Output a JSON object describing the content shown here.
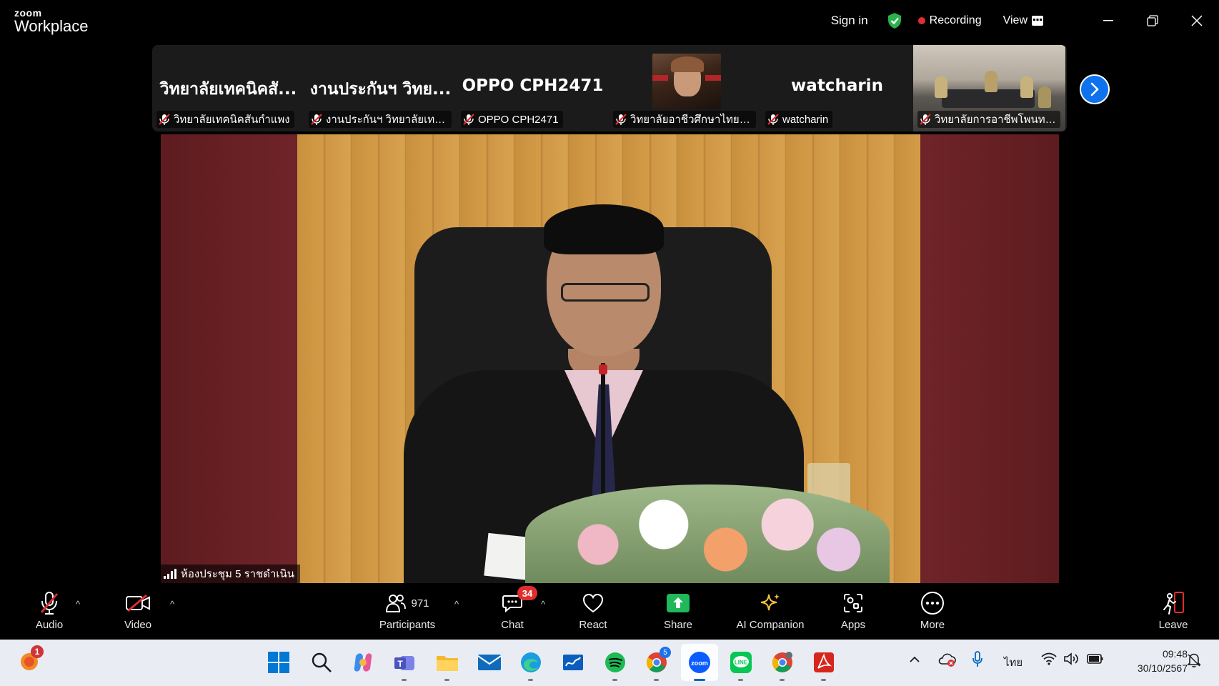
{
  "app": {
    "logo_line1": "zoom",
    "logo_line2": "Workplace",
    "sign_in": "Sign in",
    "recording": "Recording",
    "view": "View"
  },
  "thumbnails": [
    {
      "big_name": "วิทยาลัยเทคนิคสั...",
      "caption": "วิทยาลัยเทคนิคสันกำแพง",
      "type": "name"
    },
    {
      "big_name": "งานประกันฯ วิทย...",
      "caption": "งานประกันฯ วิทยาลัยเทคนิ...",
      "type": "name"
    },
    {
      "big_name": "OPPO CPH2471",
      "caption": "OPPO CPH2471",
      "type": "name"
    },
    {
      "big_name": "",
      "caption": "วิทยาลัยอาชีวศึกษาไทยเท...",
      "type": "avatar"
    },
    {
      "big_name": "watcharin",
      "caption": "watcharin",
      "type": "name"
    },
    {
      "big_name": "",
      "caption": "วิทยาลัยการอาชีพโพนทอง...",
      "type": "video"
    }
  ],
  "main_video": {
    "label": "ห้องประชุม 5 ราชดำเนิน"
  },
  "controls": {
    "audio": "Audio",
    "video": "Video",
    "participants": "Participants",
    "participants_count": "971",
    "chat": "Chat",
    "chat_badge": "34",
    "react": "React",
    "share": "Share",
    "ai_companion": "AI Companion",
    "apps": "Apps",
    "more": "More",
    "leave": "Leave"
  },
  "taskbar": {
    "notification_count": "1",
    "chrome_badge": "5",
    "language": "ไทย",
    "time": "09:48",
    "date": "30/10/2567"
  },
  "colors": {
    "accent_blue": "#0e72ed",
    "recording_red": "#e02e2e",
    "share_green": "#1fb85a",
    "shield_green": "#2bb24c"
  }
}
